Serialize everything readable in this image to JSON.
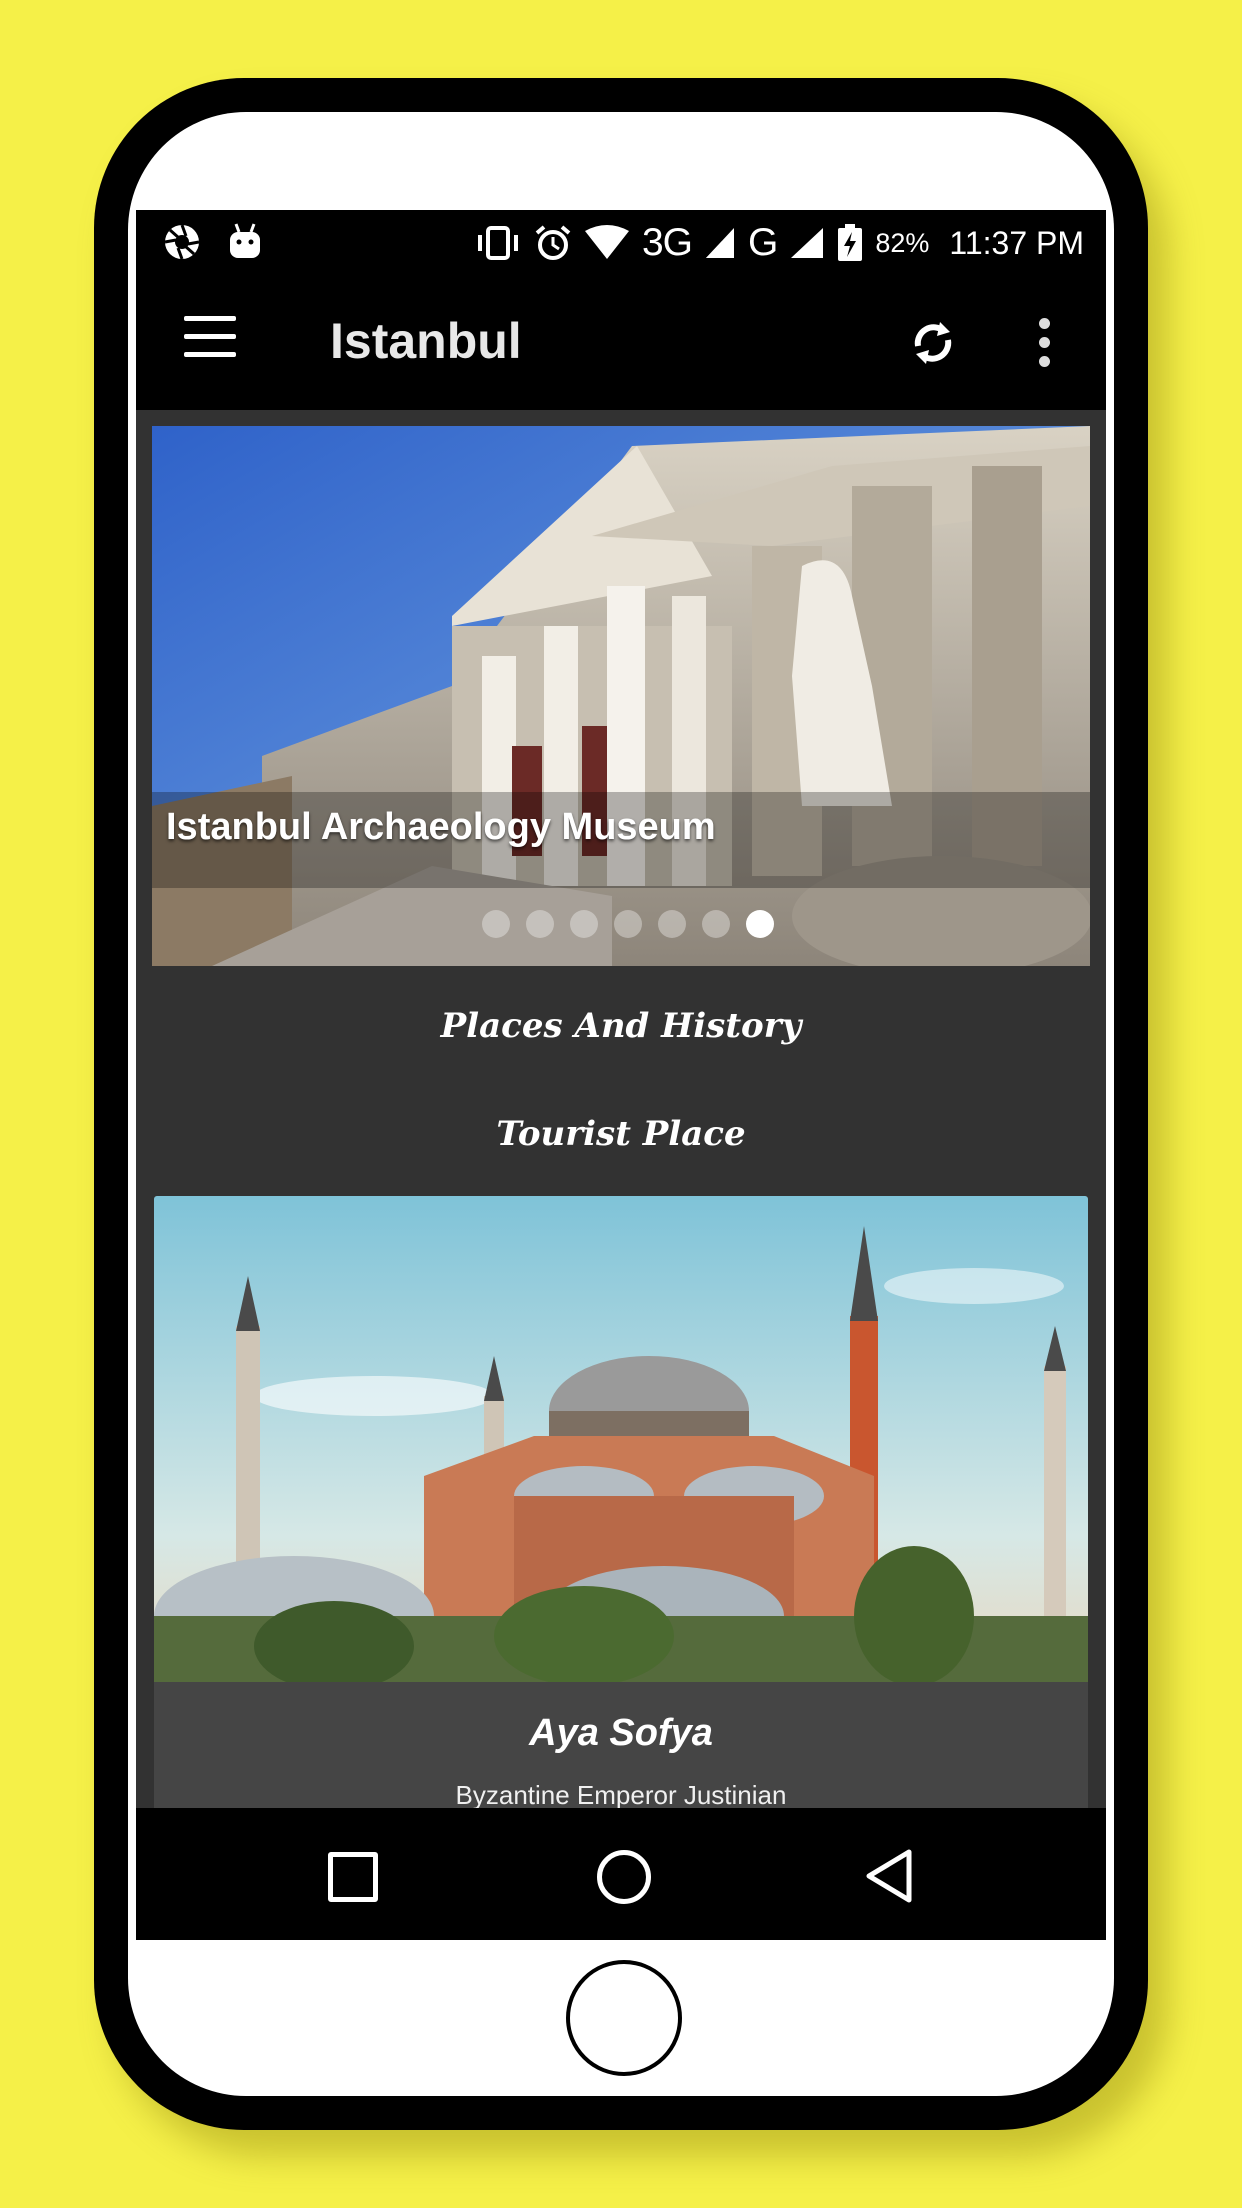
{
  "status_bar": {
    "network_3g": "3G",
    "network_g": "G",
    "battery": "82%",
    "time": "11:37 PM"
  },
  "app_bar": {
    "title": "Istanbul",
    "menu_icon": "hamburger-menu-icon",
    "refresh_icon": "refresh-icon",
    "overflow_icon": "more-vert-icon"
  },
  "slider": {
    "caption": "Istanbul Archaeology Museum",
    "dot_count": 7,
    "active_dot": 7
  },
  "sections": {
    "places_heading": "Places And History",
    "tourist_heading": "Tourist Place"
  },
  "card": {
    "title": "Aya Sofya",
    "subtitle": "Byzantine Emperor Justinian"
  },
  "colors": {
    "background": "#f5f048",
    "screen_bg": "#323232",
    "card_bg": "#454545",
    "bar_bg": "#000000"
  }
}
